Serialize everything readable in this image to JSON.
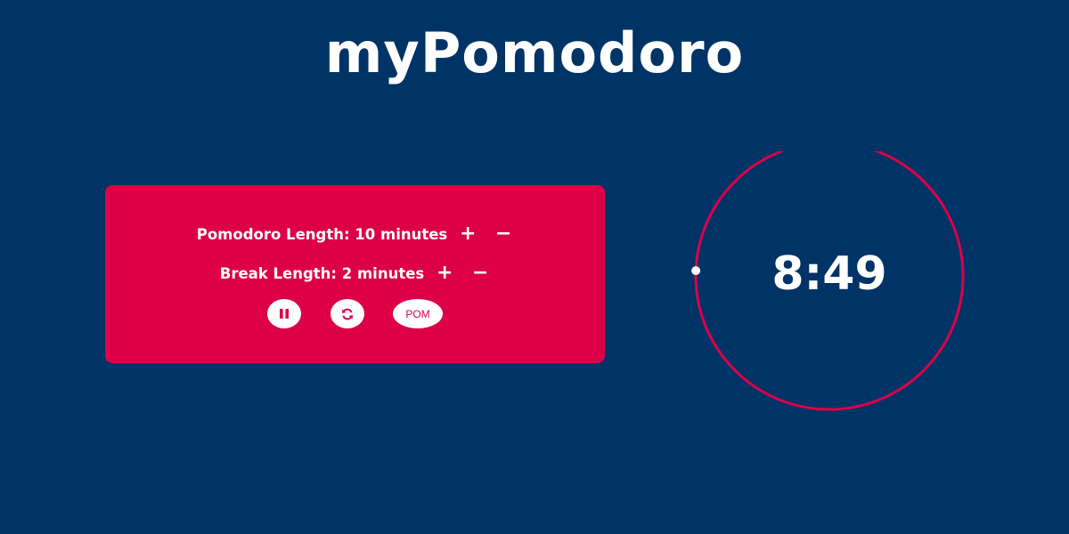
{
  "app": {
    "title": "myPomodoro"
  },
  "settings": {
    "pomodoro_label": "Pomodoro Length: 10 minutes",
    "break_label": "Break Length: 2 minutes",
    "increase_symbol": "+",
    "decrease_symbol": "−"
  },
  "controls": {
    "pause_icon": "pause-icon",
    "reset_icon": "refresh-icon",
    "mode_label": "POM"
  },
  "timer": {
    "display": "8:49",
    "progress_fraction": 0.12
  },
  "colors": {
    "background": "#003366",
    "accent": "#dd0048",
    "text": "#ffffff"
  }
}
